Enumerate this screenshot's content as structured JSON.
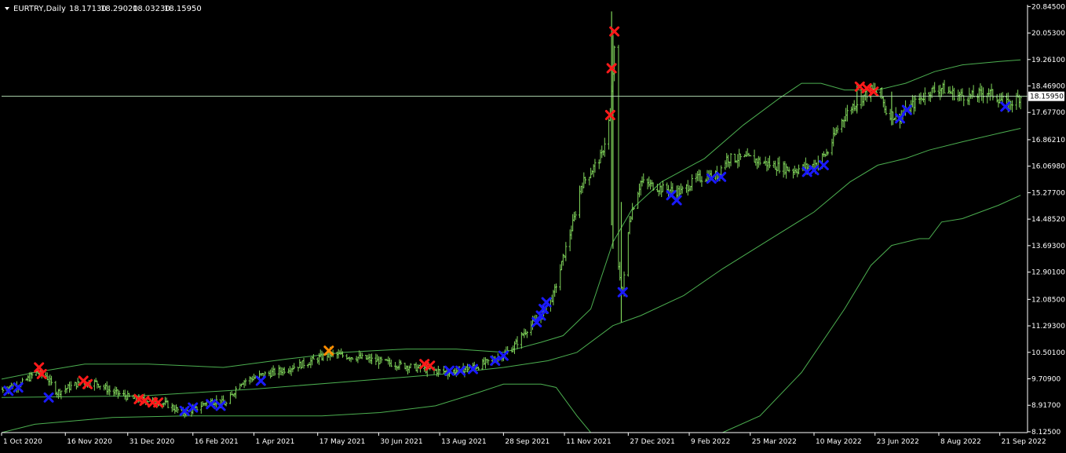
{
  "colors": {
    "background": "#000000",
    "axis": "#ffffff",
    "price": "#7fd35a",
    "bands": "#4caf50",
    "current_line": "#b0d8b0",
    "sell_marker": "#ff1a1a",
    "buy_marker": "#1a1aff",
    "mixed_marker": "#ff8c00"
  },
  "chart_data": {
    "type": "bar",
    "symbol": "EURTRY,Daily",
    "header": {
      "symbol_label": "EURTRY,Daily",
      "open": "18.17130",
      "high": "18.29020",
      "low": "18.03230",
      "close": "18.15950"
    },
    "current_price": 18.1595,
    "current_price_label": "18.15950",
    "ylim": [
      8.1,
      20.9
    ],
    "y_ticks": [
      20.845,
      20.053,
      19.261,
      18.469,
      17.677,
      16.8621,
      16.0698,
      15.277,
      14.4852,
      13.693,
      12.901,
      12.085,
      11.293,
      10.501,
      9.709,
      8.917,
      8.125
    ],
    "y_tick_labels": [
      "20.84500",
      "20.05300",
      "19.26100",
      "18.46900",
      "17.67700",
      "16.86210",
      "16.06980",
      "15.27700",
      "14.48520",
      "13.69300",
      "12.90100",
      "12.08500",
      "11.29300",
      "10.50100",
      "9.70900",
      "8.91700",
      "8.12500"
    ],
    "x_range": [
      "2020-10-01",
      "2022-10-11"
    ],
    "x_ticks": [
      "2020-10-01",
      "2020-11-16",
      "2020-12-31",
      "2021-02-16",
      "2021-04-01",
      "2021-05-17",
      "2021-06-30",
      "2021-08-13",
      "2021-09-28",
      "2021-11-11",
      "2021-12-27",
      "2022-02-09",
      "2022-03-25",
      "2022-05-10",
      "2022-06-23",
      "2022-08-08",
      "2022-09-21"
    ],
    "x_tick_labels": [
      "1 Oct 2020",
      "16 Nov 2020",
      "31 Dec 2020",
      "16 Feb 2021",
      "1 Apr 2021",
      "17 May 2021",
      "30 Jun 2021",
      "13 Aug 2021",
      "28 Sep 2021",
      "11 Nov 2021",
      "27 Dec 2021",
      "9 Feb 2022",
      "25 Mar 2022",
      "10 May 2022",
      "23 Jun 2022",
      "8 Aug 2022",
      "21 Sep 2022"
    ],
    "price_path": [
      [
        "2020-10-01",
        9.4
      ],
      [
        "2020-10-15",
        9.55
      ],
      [
        "2020-10-26",
        9.9
      ],
      [
        "2020-11-02",
        9.8
      ],
      [
        "2020-11-10",
        9.3
      ],
      [
        "2020-11-24",
        9.55
      ],
      [
        "2020-12-08",
        9.6
      ],
      [
        "2020-12-18",
        9.35
      ],
      [
        "2021-01-05",
        9.1
      ],
      [
        "2021-01-18",
        9.05
      ],
      [
        "2021-01-28",
        8.95
      ],
      [
        "2021-02-08",
        8.7
      ],
      [
        "2021-02-18",
        8.8
      ],
      [
        "2021-02-25",
        9.0
      ],
      [
        "2021-03-05",
        9.05
      ],
      [
        "2021-03-12",
        8.95
      ],
      [
        "2021-03-22",
        9.6
      ],
      [
        "2021-04-05",
        9.8
      ],
      [
        "2021-04-20",
        9.95
      ],
      [
        "2021-05-10",
        10.2
      ],
      [
        "2021-05-25",
        10.45
      ],
      [
        "2021-06-15",
        10.35
      ],
      [
        "2021-07-05",
        10.2
      ],
      [
        "2021-08-01",
        10.0
      ],
      [
        "2021-08-20",
        9.9
      ],
      [
        "2021-09-10",
        10.1
      ],
      [
        "2021-09-25",
        10.35
      ],
      [
        "2021-10-05",
        10.65
      ],
      [
        "2021-10-15",
        11.2
      ],
      [
        "2021-10-25",
        11.6
      ],
      [
        "2021-11-03",
        12.2
      ],
      [
        "2021-11-10",
        13.3
      ],
      [
        "2021-11-18",
        14.5
      ],
      [
        "2021-11-23",
        15.5
      ],
      [
        "2021-11-30",
        15.9
      ],
      [
        "2021-12-08",
        16.4
      ],
      [
        "2021-12-14",
        17.6
      ],
      [
        "2021-12-17",
        19.5
      ],
      [
        "2021-12-20",
        13.0
      ],
      [
        "2021-12-23",
        12.3
      ],
      [
        "2021-12-28",
        14.5
      ],
      [
        "2022-01-05",
        15.6
      ],
      [
        "2022-01-20",
        15.4
      ],
      [
        "2022-02-03",
        15.3
      ],
      [
        "2022-02-15",
        15.7
      ],
      [
        "2022-03-01",
        15.8
      ],
      [
        "2022-03-08",
        16.3
      ],
      [
        "2022-03-25",
        16.3
      ],
      [
        "2022-04-10",
        16.1
      ],
      [
        "2022-04-25",
        15.95
      ],
      [
        "2022-05-10",
        16.1
      ],
      [
        "2022-05-20",
        16.5
      ],
      [
        "2022-05-28",
        17.3
      ],
      [
        "2022-06-05",
        17.8
      ],
      [
        "2022-06-13",
        18.1
      ],
      [
        "2022-06-20",
        18.35
      ],
      [
        "2022-06-27",
        18.25
      ],
      [
        "2022-07-01",
        17.7
      ],
      [
        "2022-07-10",
        17.5
      ],
      [
        "2022-07-20",
        17.9
      ],
      [
        "2022-08-01",
        18.3
      ],
      [
        "2022-08-10",
        18.4
      ],
      [
        "2022-08-20",
        18.2
      ],
      [
        "2022-09-01",
        18.15
      ],
      [
        "2022-09-12",
        18.3
      ],
      [
        "2022-09-20",
        18.1
      ],
      [
        "2022-09-27",
        17.9
      ],
      [
        "2022-10-06",
        18.16
      ]
    ],
    "spikes": [
      {
        "date": "2021-12-15",
        "high": 20.7,
        "low": 14.3
      },
      {
        "date": "2021-12-16",
        "high": 20.0,
        "low": 13.6
      },
      {
        "date": "2021-12-22",
        "high": 15.0,
        "low": 11.4
      },
      {
        "date": "2022-06-10",
        "high": 18.55,
        "low": 17.7
      },
      {
        "date": "2022-07-05",
        "high": 18.3,
        "low": 17.3
      }
    ],
    "upper_band": [
      [
        "2020-10-01",
        9.7
      ],
      [
        "2020-10-25",
        9.9
      ],
      [
        "2020-11-30",
        10.15
      ],
      [
        "2021-01-15",
        10.15
      ],
      [
        "2021-03-10",
        10.05
      ],
      [
        "2021-04-25",
        10.3
      ],
      [
        "2021-06-05",
        10.5
      ],
      [
        "2021-07-20",
        10.6
      ],
      [
        "2021-08-25",
        10.6
      ],
      [
        "2021-09-28",
        10.5
      ],
      [
        "2021-10-25",
        10.8
      ],
      [
        "2021-11-10",
        11.0
      ],
      [
        "2021-11-30",
        11.8
      ],
      [
        "2021-12-16",
        13.8
      ],
      [
        "2021-12-30",
        14.8
      ],
      [
        "2022-01-20",
        15.6
      ],
      [
        "2022-02-20",
        16.3
      ],
      [
        "2022-03-20",
        17.3
      ],
      [
        "2022-04-15",
        18.1
      ],
      [
        "2022-05-01",
        18.55
      ],
      [
        "2022-05-15",
        18.55
      ],
      [
        "2022-06-01",
        18.35
      ],
      [
        "2022-06-25",
        18.35
      ],
      [
        "2022-07-15",
        18.55
      ],
      [
        "2022-08-05",
        18.9
      ],
      [
        "2022-08-25",
        19.1
      ],
      [
        "2022-09-20",
        19.2
      ],
      [
        "2022-10-06",
        19.25
      ]
    ],
    "middle_band": [
      [
        "2020-10-01",
        9.15
      ],
      [
        "2021-01-10",
        9.2
      ],
      [
        "2021-04-01",
        9.4
      ],
      [
        "2021-06-01",
        9.6
      ],
      [
        "2021-08-15",
        9.85
      ],
      [
        "2021-09-28",
        10.05
      ],
      [
        "2021-10-30",
        10.25
      ],
      [
        "2021-11-20",
        10.5
      ],
      [
        "2021-12-16",
        11.3
      ],
      [
        "2022-01-05",
        11.6
      ],
      [
        "2022-02-05",
        12.2
      ],
      [
        "2022-03-05",
        13.0
      ],
      [
        "2022-04-05",
        13.8
      ],
      [
        "2022-05-10",
        14.7
      ],
      [
        "2022-06-05",
        15.6
      ],
      [
        "2022-06-25",
        16.1
      ],
      [
        "2022-07-15",
        16.3
      ],
      [
        "2022-08-01",
        16.55
      ],
      [
        "2022-08-25",
        16.8
      ],
      [
        "2022-09-20",
        17.05
      ],
      [
        "2022-10-06",
        17.2
      ]
    ],
    "lower_band": [
      [
        "2020-10-01",
        8.1
      ],
      [
        "2020-10-25",
        8.35
      ],
      [
        "2020-12-20",
        8.55
      ],
      [
        "2021-02-10",
        8.6
      ],
      [
        "2021-04-01",
        8.6
      ],
      [
        "2021-05-20",
        8.6
      ],
      [
        "2021-07-01",
        8.7
      ],
      [
        "2021-08-10",
        8.9
      ],
      [
        "2021-09-10",
        9.3
      ],
      [
        "2021-09-28",
        9.55
      ],
      [
        "2021-10-25",
        9.55
      ],
      [
        "2021-11-05",
        9.45
      ],
      [
        "2021-11-20",
        8.6
      ],
      [
        "2021-12-10",
        7.6
      ]
    ],
    "lower_band_2": [
      [
        "2022-03-05",
        8.1
      ],
      [
        "2022-04-01",
        8.6
      ],
      [
        "2022-05-01",
        9.9
      ],
      [
        "2022-06-01",
        11.8
      ],
      [
        "2022-06-20",
        13.1
      ],
      [
        "2022-07-05",
        13.7
      ],
      [
        "2022-07-25",
        13.9
      ],
      [
        "2022-08-01",
        13.9
      ],
      [
        "2022-08-10",
        14.4
      ],
      [
        "2022-08-25",
        14.5
      ],
      [
        "2022-09-20",
        14.9
      ],
      [
        "2022-10-06",
        15.2
      ]
    ],
    "sell_markers": [
      [
        "2020-10-28",
        10.05
      ],
      [
        "2020-10-30",
        9.85
      ],
      [
        "2020-11-29",
        9.65
      ],
      [
        "2020-12-02",
        9.55
      ],
      [
        "2021-01-08",
        9.1
      ],
      [
        "2021-01-12",
        9.05
      ],
      [
        "2021-01-18",
        9.0
      ],
      [
        "2021-01-22",
        9.0
      ],
      [
        "2021-08-02",
        10.15
      ],
      [
        "2021-08-06",
        10.1
      ],
      [
        "2021-12-14",
        17.6
      ],
      [
        "2021-12-15",
        19.0
      ],
      [
        "2021-12-17",
        20.1
      ],
      [
        "2022-06-12",
        18.45
      ],
      [
        "2022-06-17",
        18.4
      ],
      [
        "2022-06-22",
        18.3
      ]
    ],
    "buy_markers": [
      [
        "2020-10-06",
        9.35
      ],
      [
        "2020-10-13",
        9.45
      ],
      [
        "2020-11-04",
        9.15
      ],
      [
        "2021-02-10",
        8.75
      ],
      [
        "2021-02-16",
        8.85
      ],
      [
        "2021-03-01",
        8.95
      ],
      [
        "2021-03-08",
        8.9
      ],
      [
        "2021-04-06",
        9.65
      ],
      [
        "2021-08-20",
        9.95
      ],
      [
        "2021-08-28",
        9.95
      ],
      [
        "2021-09-06",
        10.0
      ],
      [
        "2021-09-22",
        10.25
      ],
      [
        "2021-09-28",
        10.4
      ],
      [
        "2021-10-22",
        11.4
      ],
      [
        "2021-10-25",
        11.6
      ],
      [
        "2021-10-27",
        11.8
      ],
      [
        "2021-10-29",
        12.0
      ],
      [
        "2021-12-23",
        12.3
      ],
      [
        "2022-01-27",
        15.2
      ],
      [
        "2022-01-31",
        15.05
      ],
      [
        "2022-02-25",
        15.7
      ],
      [
        "2022-03-04",
        15.75
      ],
      [
        "2022-05-05",
        15.9
      ],
      [
        "2022-05-10",
        15.95
      ],
      [
        "2022-05-17",
        16.1
      ],
      [
        "2022-07-11",
        17.5
      ],
      [
        "2022-07-16",
        17.75
      ],
      [
        "2022-09-25",
        17.85
      ]
    ],
    "mixed_markers": [
      [
        "2021-05-25",
        10.55
      ]
    ]
  }
}
